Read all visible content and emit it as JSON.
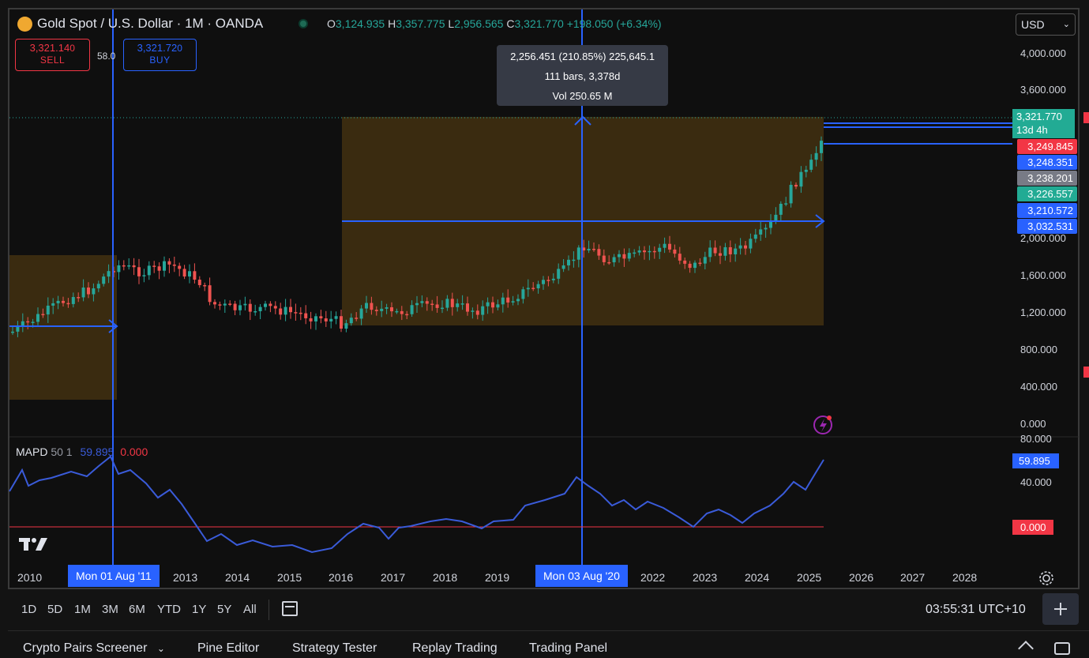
{
  "header": {
    "symbol_title": "Gold Spot / U.S. Dollar · 1M · OANDA",
    "ohlc": {
      "o_label": "O",
      "o": "3,124.935",
      "h_label": "H",
      "h": "3,357.775",
      "l_label": "L",
      "l": "2,956.565",
      "c_label": "C",
      "c": "3,321.770",
      "change": "+198.050 (+6.34%)"
    },
    "sell_price": "3,321.14",
    "sell_price_small": "0",
    "sell_label": "SELL",
    "spread": "58.0",
    "buy_price": "3,321.72",
    "buy_price_small": "0",
    "buy_label": "BUY",
    "currency": "USD"
  },
  "measure_tooltip": {
    "line1": "2,256.451 (210.85%) 225,645.1",
    "line2": "111 bars, 3,378d",
    "line3": "Vol 250.65 M"
  },
  "price_axis": [
    "4,000.000",
    "3,600.000",
    "2,000.000",
    "1,600.000",
    "1,200.000",
    "800.000",
    "400.000",
    "0.000"
  ],
  "price_labels": [
    {
      "value": "3,321.770",
      "sub": "13d 4h",
      "color": "#22ab94"
    },
    {
      "value": "3,249.845",
      "color": "#f23645"
    },
    {
      "value": "3,248.351",
      "color": "#2962ff"
    },
    {
      "value": "3,238.201",
      "color": "#787b86"
    },
    {
      "value": "3,226.557",
      "color": "#22ab94"
    },
    {
      "value": "3,210.572",
      "color": "#2962ff"
    },
    {
      "value": "3,032.531",
      "color": "#2962ff"
    }
  ],
  "indicator": {
    "name": "MAPD",
    "params": "50 1",
    "value1": "59.895",
    "value2": "0.000",
    "axis_top": "80.000",
    "axis_mid": "40.000",
    "label_value": "59.895",
    "label_zero": "0.000"
  },
  "time_axis": [
    "2010",
    "2013",
    "2014",
    "2015",
    "2016",
    "2017",
    "2018",
    "2019",
    "2022",
    "2023",
    "2024",
    "2025",
    "2026",
    "2027",
    "2028"
  ],
  "time_badges": {
    "left": "Mon 01 Aug '11",
    "right": "Mon 03 Aug '20"
  },
  "ranges": [
    "1D",
    "5D",
    "1M",
    "3M",
    "6M",
    "YTD",
    "1Y",
    "5Y",
    "All"
  ],
  "clock": "03:55:31 UTC+10",
  "bottom_tabs": [
    "Crypto Pairs Screener",
    "Pine Editor",
    "Strategy Tester",
    "Replay Trading",
    "Trading Panel"
  ],
  "icons": {
    "logo": "gold-coin-icon",
    "status": "market-open-dot-icon",
    "calendar": "calendar-range-icon",
    "settings": "gear-icon",
    "tv": "tradingview-logo-icon",
    "alert": "lightning-icon",
    "collapse": "chevron-up-icon",
    "maximize": "maximize-icon",
    "crosshair": "crosshair-icon",
    "dropdown": "chevron-down-icon"
  },
  "colors": {
    "up": "#26a69a",
    "down": "#ef5350",
    "measure": "#2962ff",
    "box_fill": "#4a3512",
    "mapd_line": "#3a5bd9",
    "zero_line": "#f23645"
  }
}
